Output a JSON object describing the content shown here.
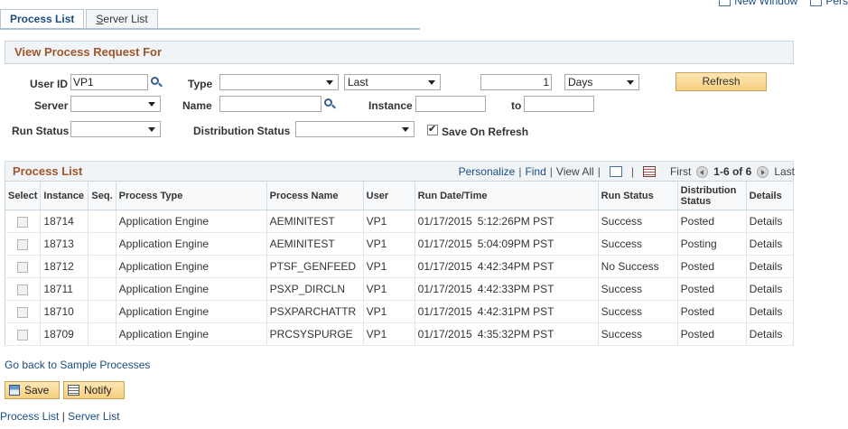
{
  "top_links": {
    "new_window": "New Window",
    "personalize": "Pers"
  },
  "tabs": [
    {
      "label": "Process List",
      "active": true
    },
    {
      "label_first": "S",
      "label_rest": "erver List",
      "active": false
    }
  ],
  "section": {
    "title": "View Process Request For"
  },
  "form": {
    "user_id_label": "User ID",
    "user_id_value": "VP1",
    "type_label": "Type",
    "type_value": "",
    "last_value": "Last",
    "days_count": "1",
    "days_unit": "Days",
    "refresh_label": "Refresh",
    "server_label": "Server",
    "server_value": "",
    "name_label": "Name",
    "name_value": "",
    "instance_label": "Instance",
    "instance_from": "",
    "to_label": "to",
    "instance_to": "",
    "run_status_label": "Run Status",
    "run_status_value": "",
    "dist_status_label": "Distribution Status",
    "dist_status_value": "",
    "save_on_refresh_label": "Save On Refresh",
    "save_on_refresh_checked": true
  },
  "grid": {
    "title": "Process List",
    "personalize": "Personalize",
    "find": "Find",
    "view_all": "View All",
    "first": "First",
    "range": "1-6 of 6",
    "last": "Last",
    "columns": [
      "Select",
      "Instance",
      "Seq.",
      "Process Type",
      "Process Name",
      "User",
      "Run Date/Time",
      "Run Status",
      "Distribution Status",
      "Details"
    ],
    "rows": [
      {
        "instance": "18714",
        "seq": "",
        "type": "Application Engine",
        "name": "AEMINITEST",
        "user": "VP1",
        "date": "01/17/2015",
        "time": "5:12:26PM PST",
        "status": "Success",
        "dist": "Posted",
        "details": "Details"
      },
      {
        "instance": "18713",
        "seq": "",
        "type": "Application Engine",
        "name": "AEMINITEST",
        "user": "VP1",
        "date": "01/17/2015",
        "time": "5:04:09PM PST",
        "status": "Success",
        "dist": "Posting",
        "details": "Details"
      },
      {
        "instance": "18712",
        "seq": "",
        "type": "Application Engine",
        "name": "PTSF_GENFEED",
        "user": "VP1",
        "date": "01/17/2015",
        "time": "4:42:34PM PST",
        "status": "No Success",
        "dist": "Posted",
        "details": "Details"
      },
      {
        "instance": "18711",
        "seq": "",
        "type": "Application Engine",
        "name": "PSXP_DIRCLN",
        "user": "VP1",
        "date": "01/17/2015",
        "time": "4:42:33PM PST",
        "status": "Success",
        "dist": "Posted",
        "details": "Details"
      },
      {
        "instance": "18710",
        "seq": "",
        "type": "Application Engine",
        "name": "PSXPARCHATTR",
        "user": "VP1",
        "date": "01/17/2015",
        "time": "4:42:31PM PST",
        "status": "Success",
        "dist": "Posted",
        "details": "Details"
      },
      {
        "instance": "18709",
        "seq": "",
        "type": "Application Engine",
        "name": "PRCSYSPURGE",
        "user": "VP1",
        "date": "01/17/2015",
        "time": "4:35:32PM PST",
        "status": "Success",
        "dist": "Posted",
        "details": "Details"
      }
    ]
  },
  "go_back": "Go back to Sample Processes",
  "buttons": {
    "save": "Save",
    "notify": "Notify"
  },
  "footer": {
    "process_list": "Process List",
    "server_list": "Server List"
  }
}
